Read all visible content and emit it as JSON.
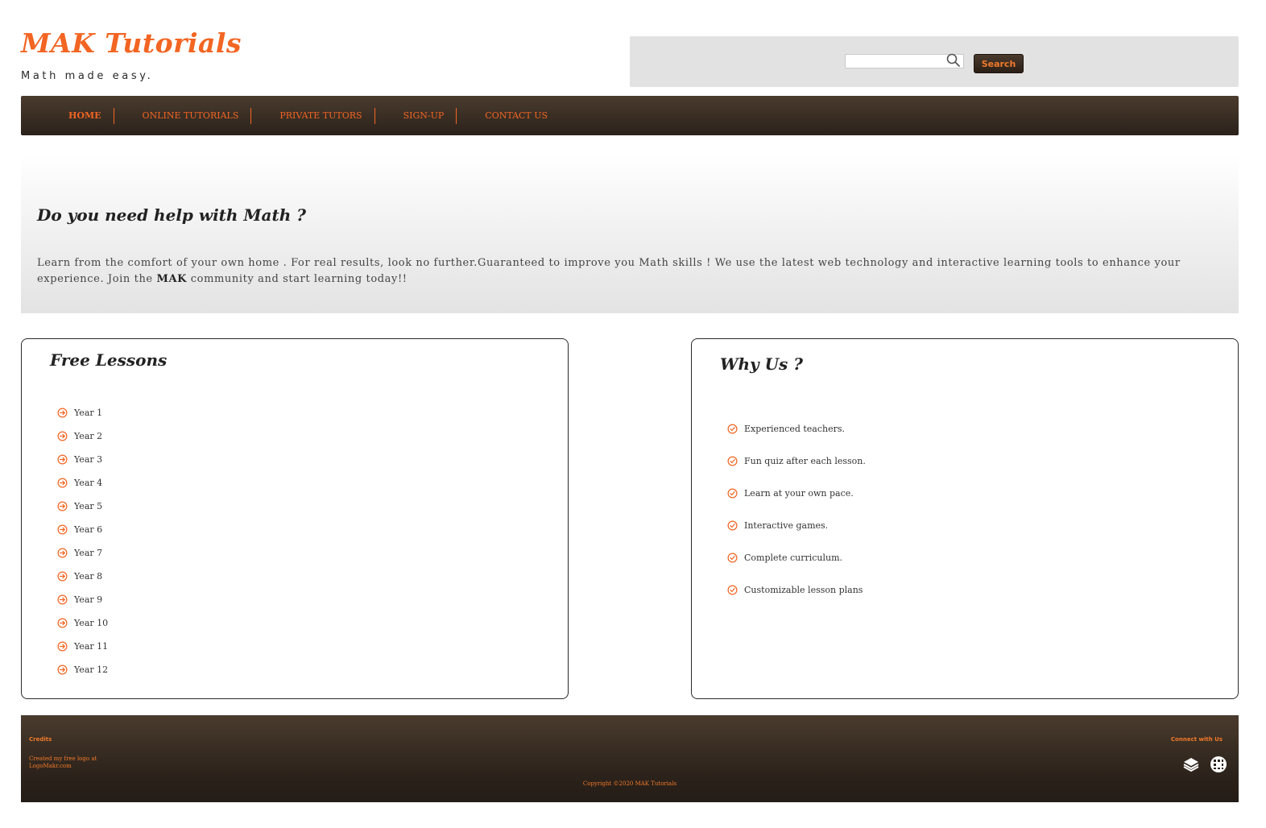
{
  "header": {
    "logo_text": "MAK Tutorials",
    "tagline": "Math made easy."
  },
  "search": {
    "value": "",
    "placeholder": "",
    "button_label": "Search",
    "icon": "magnifier-icon"
  },
  "nav": {
    "items": [
      {
        "label": "HOME",
        "active": true
      },
      {
        "label": "ONLINE TUTORIALS"
      },
      {
        "label": "PRIVATE TUTORS"
      },
      {
        "label": "SIGN-UP"
      },
      {
        "label": "CONTACT US"
      }
    ]
  },
  "hero": {
    "title": "Do you need help with Math ?",
    "text_before": "Learn from the comfort of your own home . For real results, look no further.Guaranteed to improve you Math skills ! We use the latest web technology and interactive learning tools to enhance your experience. Join the ",
    "text_bold": "MAK",
    "text_after": " community and start learning today!!"
  },
  "lessons": {
    "title": "Free Lessons",
    "icon": "arrow-circle-right-icon",
    "items": [
      "Year 1",
      "Year 2",
      "Year 3",
      "Year 4",
      "Year 5",
      "Year 6",
      "Year 7",
      "Year 8",
      "Year 9",
      "Year 10",
      "Year 11",
      "Year 12"
    ]
  },
  "why_us": {
    "title": "Why Us ?",
    "icon": "check-circle-icon",
    "items": [
      "Experienced teachers.",
      "Fun quiz after each lesson.",
      "Learn at your own pace.",
      "Interactive games.",
      "Complete curriculum.",
      "Customizable lesson plans"
    ]
  },
  "footer": {
    "credits_title": "Credits",
    "credits_text": "Created my free logo at",
    "credits_link": "LogoMakr.com",
    "connect_title": "Connect with Us",
    "copyright": "Copyright ©2020 MAK Tutorials",
    "social_icons": [
      "layers-icon",
      "grid-badge-icon"
    ]
  },
  "colors": {
    "accent": "#f26522",
    "nav_bg": "#3a2d23",
    "panel_bg": "#e2e2e2"
  }
}
